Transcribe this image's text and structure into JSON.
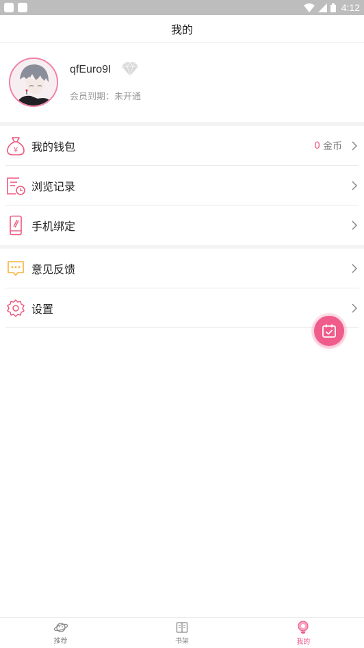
{
  "status_bar": {
    "time": "4:12"
  },
  "header": {
    "title": "我的"
  },
  "profile": {
    "username": "qfEuro9I",
    "membership": "会员到期：未开通"
  },
  "menu_group_1": [
    {
      "label": "我的钱包",
      "icon": "wallet-icon",
      "coin_value": "0",
      "coin_unit": "金币"
    },
    {
      "label": "浏览记录",
      "icon": "history-icon"
    },
    {
      "label": "手机绑定",
      "icon": "phone-icon"
    }
  ],
  "menu_group_2": [
    {
      "label": "意见反馈",
      "icon": "feedback-icon"
    },
    {
      "label": "设置",
      "icon": "settings-icon"
    }
  ],
  "tabs": [
    {
      "label": "推荐",
      "icon": "planet-icon",
      "active": false
    },
    {
      "label": "书架",
      "icon": "book-icon",
      "active": false
    },
    {
      "label": "我的",
      "icon": "profile-icon",
      "active": true
    }
  ],
  "colors": {
    "accent": "#f05c8b",
    "coin": "#f0577d",
    "feedback": "#f5b33c"
  }
}
